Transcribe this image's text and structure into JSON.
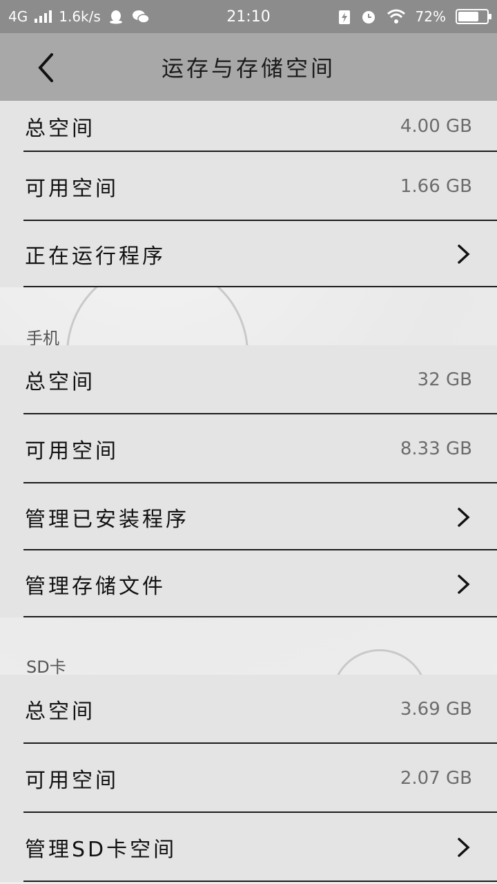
{
  "status_bar": {
    "network": "4G",
    "speed": "1.6k/s",
    "time": "21:10",
    "battery_percent": "72%",
    "battery_level": 0.72,
    "icons": [
      "signal-icon",
      "qq-icon",
      "wechat-icon",
      "charging-icon",
      "alarm-icon",
      "wifi-icon",
      "battery-icon"
    ]
  },
  "header": {
    "title": "运存与存储空间",
    "back_icon": "back-arrow-icon"
  },
  "ram": {
    "rows": [
      {
        "label": "总空间",
        "value": "4.00 GB"
      },
      {
        "label": "可用空间",
        "value": "1.66 GB"
      },
      {
        "label": "正在运行程序",
        "value": ""
      }
    ]
  },
  "phone": {
    "title": "手机",
    "rows": [
      {
        "label": "总空间",
        "value": "32 GB"
      },
      {
        "label": "可用空间",
        "value": "8.33 GB"
      },
      {
        "label": "管理已安装程序",
        "value": ""
      },
      {
        "label": "管理存储文件",
        "value": ""
      }
    ]
  },
  "sd": {
    "title": "SD卡",
    "rows": [
      {
        "label": "总空间",
        "value": "3.69 GB"
      },
      {
        "label": "可用空间",
        "value": "2.07 GB"
      },
      {
        "label": "管理SD卡空间",
        "value": ""
      }
    ]
  }
}
